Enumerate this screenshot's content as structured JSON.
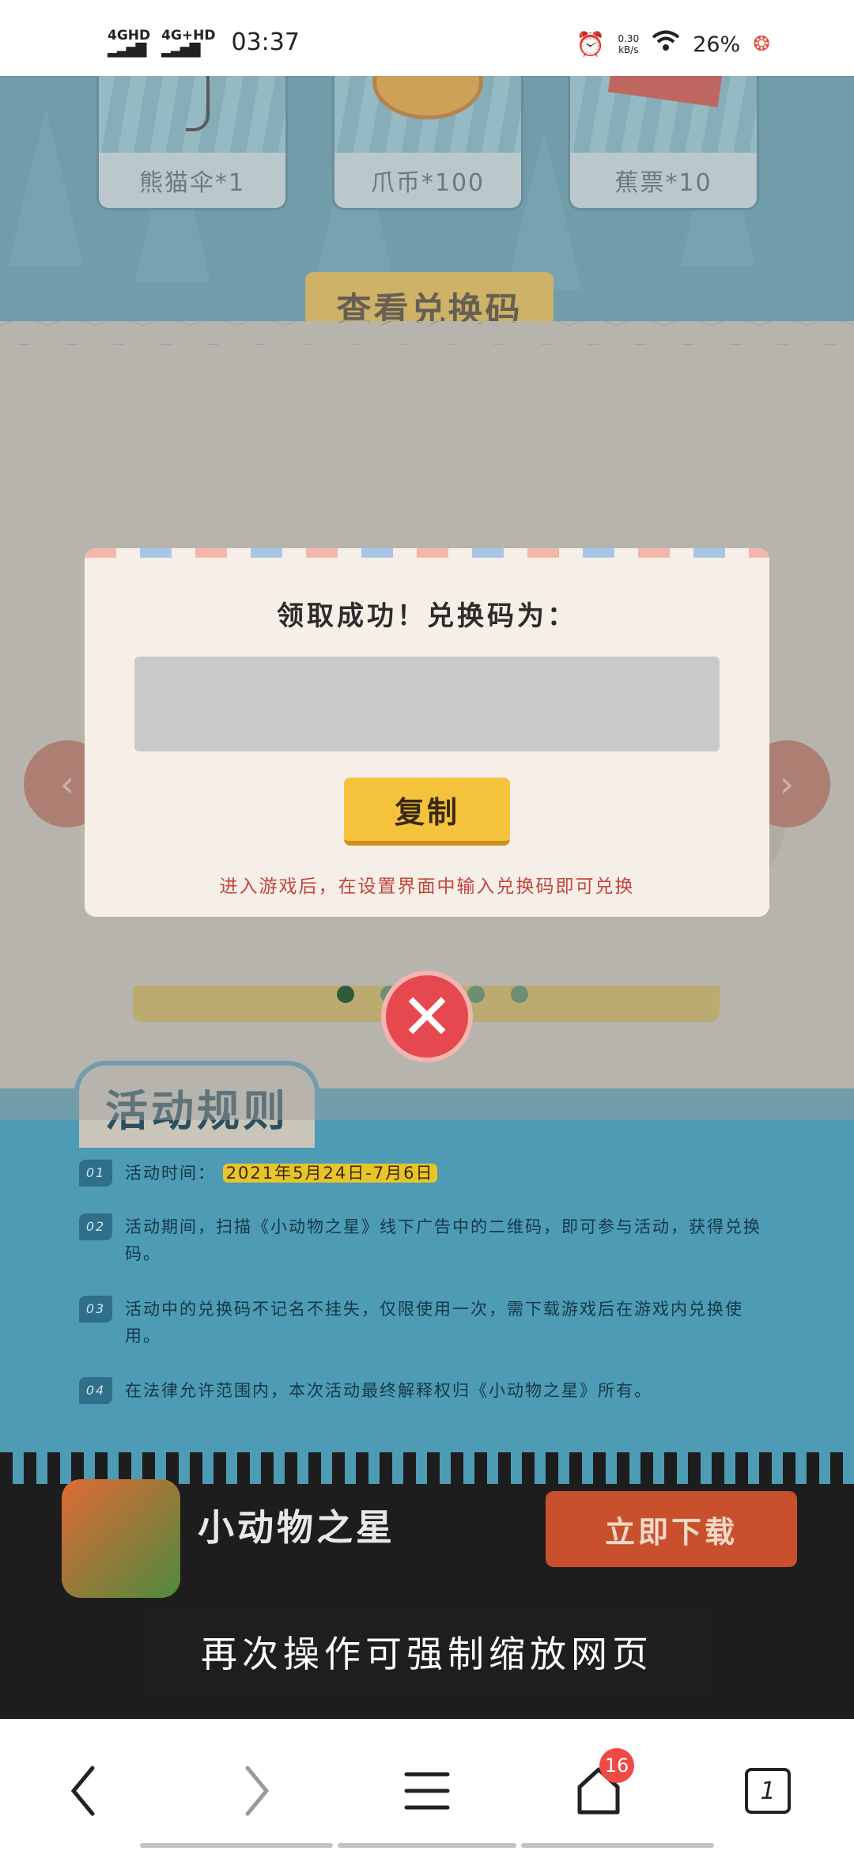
{
  "status_bar": {
    "network1": "4GHD",
    "network2": "4G+HD",
    "time": "03:37",
    "speed_value": "0.30",
    "speed_unit": "kB/s",
    "battery": "26%"
  },
  "rewards": [
    {
      "label": "熊猫伞*1"
    },
    {
      "label": "爪币*100"
    },
    {
      "label": "蕉票*10"
    }
  ],
  "view_code_button": "查看兑换码",
  "dialog": {
    "title": "领取成功！兑换码为：",
    "code_value": "",
    "copy_button": "复制",
    "hint": "进入游戏后，在设置界面中输入兑换码即可兑换"
  },
  "carousel": {
    "dot_count": 5,
    "active_index": 0
  },
  "rules": {
    "tab_title": "活动规则",
    "items": [
      {
        "num": "01",
        "text": "活动时间：",
        "highlight": "2021年5月24日-7月6日"
      },
      {
        "num": "02",
        "text": "活动期间，扫描《小动物之星》线下广告中的二维码，即可参与活动，获得兑换码。",
        "highlight": ""
      },
      {
        "num": "03",
        "text": "活动中的兑换码不记名不挂失，仅限使用一次，需下载游戏后在游戏内兑换使用。",
        "highlight": ""
      },
      {
        "num": "04",
        "text": "在法律允许范围内，本次活动最终解释权归《小动物之星》所有。",
        "highlight": ""
      }
    ]
  },
  "app_banner": {
    "name": "小动物之星",
    "download_button": "立即下载"
  },
  "toast": "再次操作可强制缩放网页",
  "browser_nav": {
    "tabs_badge": "16",
    "tab_count": "1"
  },
  "colors": {
    "accent_yellow": "#f5c23b",
    "close_red": "#e5484e",
    "hint_red": "#c2463c",
    "sky_blue": "#4c9bb5"
  }
}
